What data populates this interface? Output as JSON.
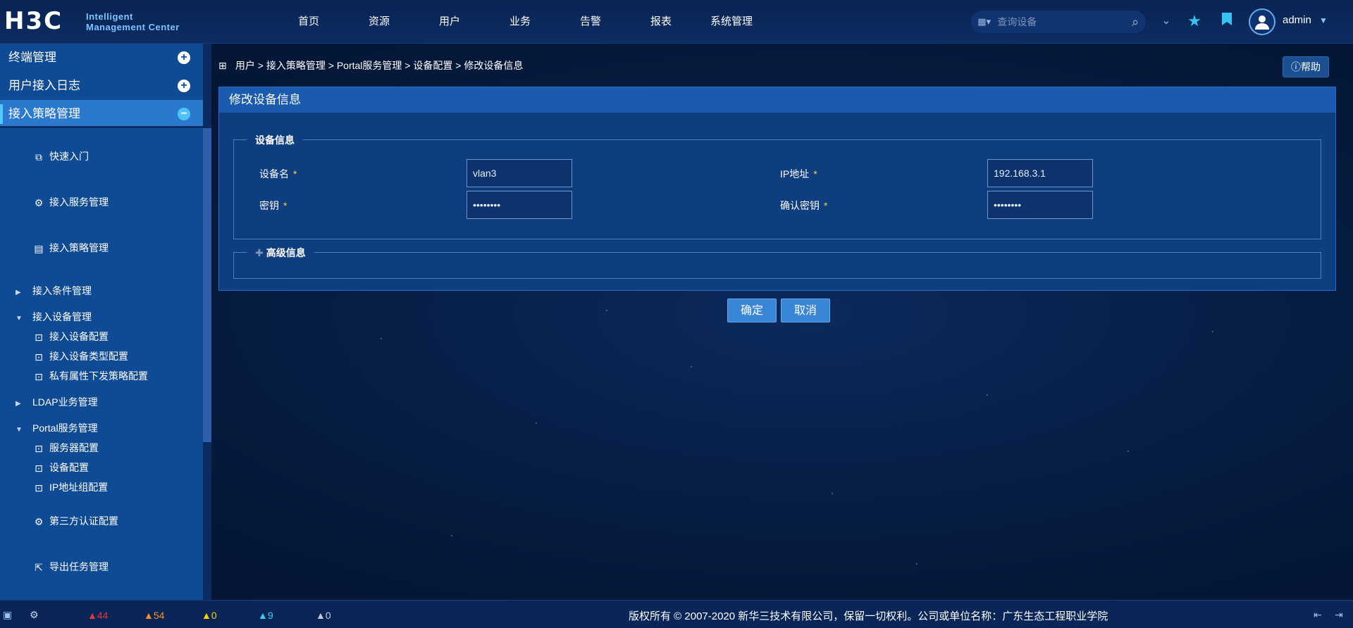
{
  "header": {
    "logo_text": "H3C",
    "logo_sub_line1": "Intelligent",
    "logo_sub_line2": "Management Center",
    "nav": [
      "首页",
      "资源",
      "用户",
      "业务",
      "告警",
      "报表",
      "系统管理"
    ],
    "search_placeholder": "查询设备",
    "user": "admin"
  },
  "sidebar": {
    "sections": [
      {
        "label": "终端管理",
        "state": "+"
      },
      {
        "label": "用户接入日志",
        "state": "+"
      },
      {
        "label": "接入策略管理",
        "state": "−"
      }
    ],
    "items": [
      {
        "label": "快速入门"
      },
      {
        "label": "接入服务管理"
      },
      {
        "label": "接入策略管理"
      },
      {
        "label": "接入条件管理"
      },
      {
        "label": "接入设备管理"
      },
      {
        "label": "接入设备配置"
      },
      {
        "label": "接入设备类型配置"
      },
      {
        "label": "私有属性下发策略配置"
      },
      {
        "label": "LDAP业务管理"
      },
      {
        "label": "Portal服务管理"
      },
      {
        "label": "服务器配置"
      },
      {
        "label": "设备配置"
      },
      {
        "label": "IP地址组配置"
      },
      {
        "label": "第三方认证配置"
      },
      {
        "label": "导出任务管理"
      }
    ]
  },
  "breadcrumb": [
    "用户",
    "接入策略管理",
    "Portal服务管理",
    "设备配置",
    "修改设备信息"
  ],
  "breadcrumb_sep": ">",
  "help_label": "帮助",
  "panel": {
    "title": "修改设备信息",
    "device_info_legend": "设备信息",
    "advanced_legend": "高级信息",
    "required_mark": "*",
    "fields": {
      "device_name": {
        "label": "设备名",
        "value": "vlan3"
      },
      "ip_address": {
        "label": "IP地址",
        "value": "192.168.3.1"
      },
      "secret": {
        "label": "密钥",
        "value": "12345678"
      },
      "confirm_secret": {
        "label": "确认密钥",
        "value": "12345678"
      }
    }
  },
  "buttons": {
    "ok": "确定",
    "cancel": "取消"
  },
  "footer": {
    "alarms": [
      {
        "name": "critical",
        "count": "44",
        "color": "#e53935"
      },
      {
        "name": "major",
        "count": "54",
        "color": "#ff8f1f"
      },
      {
        "name": "minor",
        "count": "0",
        "color": "#ffd600"
      },
      {
        "name": "warning",
        "count": "9",
        "color": "#35d0f0"
      },
      {
        "name": "unknown",
        "count": "0",
        "color": "#c9c9c9"
      }
    ],
    "copyright": "版权所有 © 2007-2020 新华三技术有限公司，保留一切权利。公司或单位名称：广东生态工程职业学院"
  },
  "colors": {
    "sidebar_bg": "#0f4a95",
    "active_section": "#2a79cf",
    "button": "#3a86d6",
    "required": "#f7d33b"
  }
}
